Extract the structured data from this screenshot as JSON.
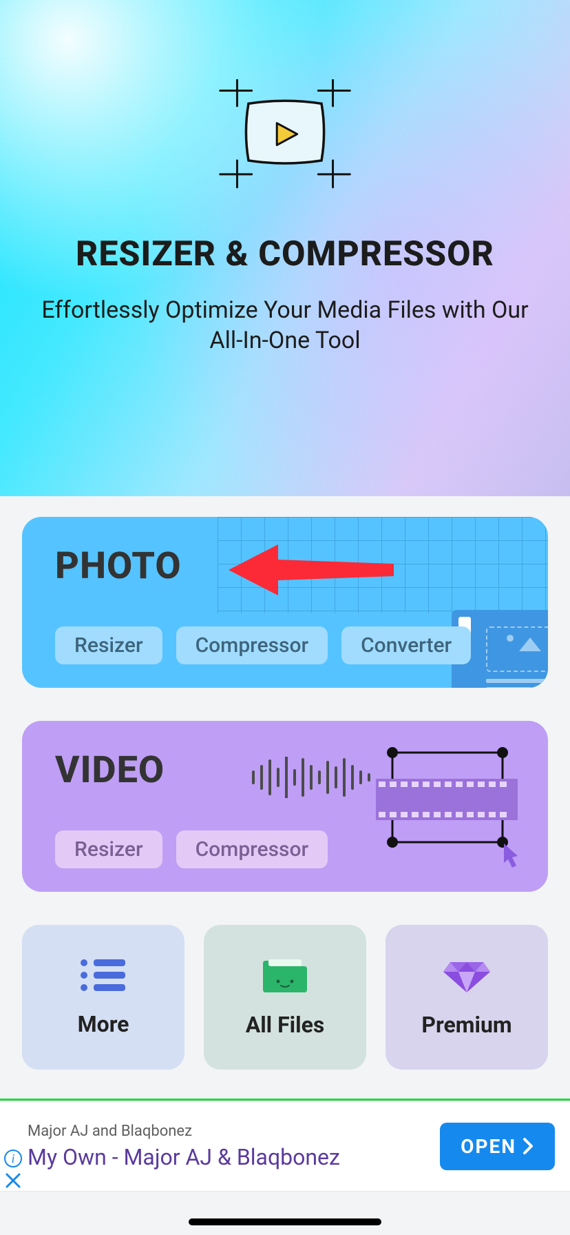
{
  "hero": {
    "title": "RESIZER  & COMPRESSOR",
    "subtitle": "Effortlessly Optimize Your Media Files with Our All-In-One Tool"
  },
  "photo_card": {
    "title": "PHOTO",
    "chips": [
      "Resizer",
      "Compressor",
      "Converter"
    ]
  },
  "video_card": {
    "title": "VIDEO",
    "chips": [
      "Resizer",
      "Compressor"
    ]
  },
  "tiles": {
    "more": "More",
    "all_files": "All Files",
    "premium": "Premium"
  },
  "ad": {
    "top_line": "Major AJ and Blaqbonez",
    "title": "My Own - Major AJ & Blaqbonez",
    "button": "OPEN"
  },
  "annotation": {
    "arrow_target": "photo-card-title"
  }
}
